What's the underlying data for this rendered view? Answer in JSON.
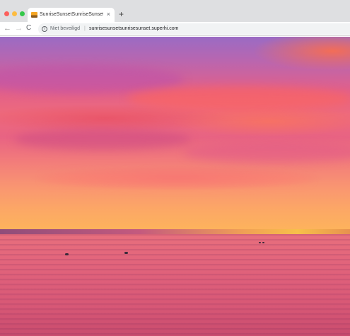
{
  "browser": {
    "tab": {
      "title": "SunriseSunsetSunriseSunset - SuperHi",
      "close_glyph": "×"
    },
    "new_tab_glyph": "+",
    "toolbar": {
      "back_glyph": "←",
      "forward_glyph": "→",
      "reload_glyph": "C",
      "info_glyph": "i",
      "security_label": "Niet beveiligd",
      "separator": "|",
      "url": "sunrisesunsetsunrisesunset.superhi.com"
    },
    "window_controls": [
      "close",
      "minimize",
      "maximize"
    ]
  },
  "page": {
    "content": "sunset-photo",
    "colors": {
      "sky_top": "#9a6bc4",
      "sky_mid": "#ee6a7c",
      "sky_bottom": "#fdb35c",
      "sea": "#e4677c"
    }
  }
}
